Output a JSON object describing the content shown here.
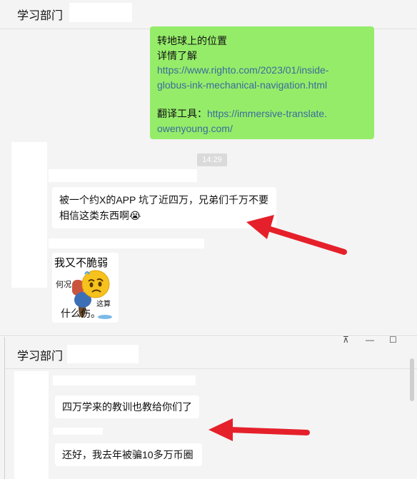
{
  "top_window": {
    "title": "学习部门",
    "green_message": {
      "line1": "转地球上的位置",
      "line2": "详情了解",
      "link1a": "https://www.righto.com/2023/01/inside-",
      "link1b": "globus-ink-mechanical-navigation.html",
      "tool_label": "翻译工具：",
      "link2a": "https://immersive-translate.",
      "link2b": "owenyoung.com/"
    },
    "timestamp": "14:29",
    "message1_line1": "被一个约X的APP 坑了近四万，兄弟们千万不要",
    "message1_line2": "相信这类东西啊",
    "message1_emoji": "😭",
    "sticker": {
      "big_text": "我又不脆弱",
      "small1": "何况",
      "small2": "这算",
      "small3": "什么伤。"
    }
  },
  "second_window": {
    "title": "学习部门",
    "controls": [
      "⊼",
      "—",
      "☐"
    ],
    "message2": "四万学来的教训也教给你们了",
    "message3": "还好，我去年被骗10多万币圈"
  },
  "colors": {
    "chat_bg": "#f4f4f4",
    "self_bubble": "#95ec69",
    "other_bubble": "#ffffff",
    "link": "#3b6c9c",
    "annotation_arrow": "#e5202a"
  }
}
